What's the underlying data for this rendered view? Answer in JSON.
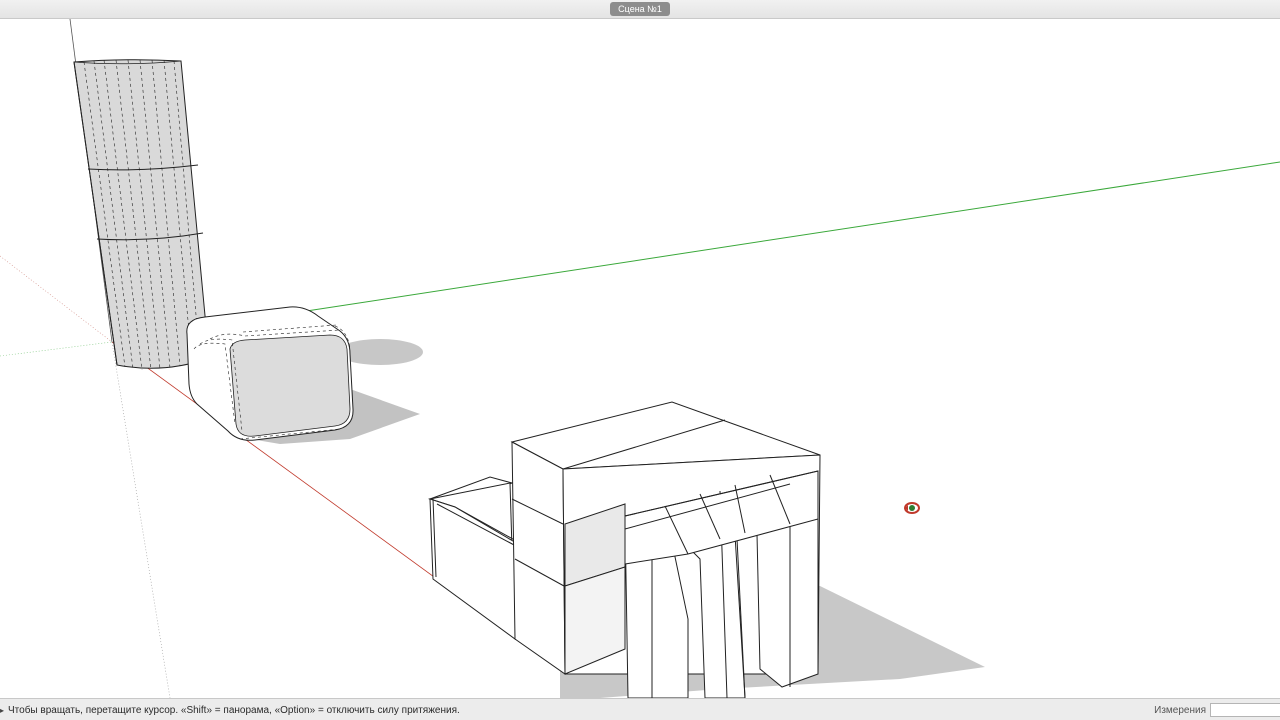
{
  "scene_tabs": {
    "active_scene": "Сцена №1"
  },
  "status_bar": {
    "icon": "info-triangle-icon",
    "message": "Чтобы вращать, перетащите курсор. «Shift» = панорама, «Option» = отключить силу притяжения.",
    "measurements_label": "Измерения",
    "measurements_value": ""
  },
  "viewport": {
    "cursor": "orbit-cursor-icon",
    "axis_colors": {
      "green_axis": "#3aa83a",
      "red_axis": "#c0392b",
      "blue_axis": "#555555"
    },
    "objects": [
      "cylinder",
      "rounded-box",
      "stool",
      "bench-block"
    ]
  }
}
